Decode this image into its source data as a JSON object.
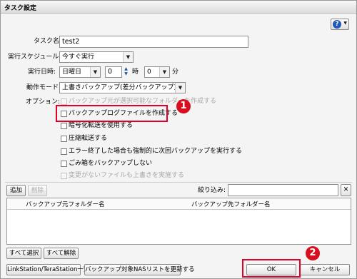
{
  "window": {
    "title": "タスク設定"
  },
  "help": {
    "icon": "help-icon",
    "symbol": "?"
  },
  "form": {
    "task_name_label": "タスク名:",
    "task_name_value": "test2",
    "schedule_label": "実行スケジュール:",
    "schedule_value": "今すぐ実行",
    "date_label": "実行日時:",
    "day_value": "日曜日",
    "hour_value": "0",
    "hour_unit": "時",
    "minute_value": "0",
    "minute_unit": "分",
    "mode_label": "動作モード:",
    "mode_value": "上書きバックアップ(差分バックアップ)",
    "options_label": "オプション:"
  },
  "options": [
    {
      "label": "バックアップ元が選択可能なフォルダーを作成する",
      "checked": false,
      "disabled": true
    },
    {
      "label": "バックアップログファイルを作成する",
      "checked": false,
      "disabled": false
    },
    {
      "label": "暗号化転送を使用する",
      "checked": false,
      "disabled": false
    },
    {
      "label": "圧縮転送する",
      "checked": false,
      "disabled": false
    },
    {
      "label": "エラー終了した場合も強制的に次回バックアップを実行する",
      "checked": false,
      "disabled": false
    },
    {
      "label": "ごみ箱をバックアップしない",
      "checked": false,
      "disabled": false
    },
    {
      "label": "変更がないファイルも上書きを実施する",
      "checked": false,
      "disabled": true
    }
  ],
  "list": {
    "add_button": "追加",
    "delete_button": "削除",
    "filter_label": "絞り込み:",
    "filter_value": "",
    "clear_symbol": "✕",
    "columns": [
      "バックアップ元フォルダー名",
      "バックアップ先フォルダー名"
    ],
    "select_all_button": "すべて選択",
    "deselect_all_button": "すべて解除"
  },
  "footer": {
    "linkstation_button": "LinkStation/TeraStation一覧",
    "refresh_button": "バックアップ対象NASリストを更新する",
    "ok_button": "OK",
    "cancel_button": "キャンセル"
  },
  "callouts": {
    "one": "1",
    "two": "2"
  },
  "colors": {
    "callout_red": "#d80f1f",
    "highlight_red": "#e0002a",
    "help_blue": "#1f58b6"
  }
}
